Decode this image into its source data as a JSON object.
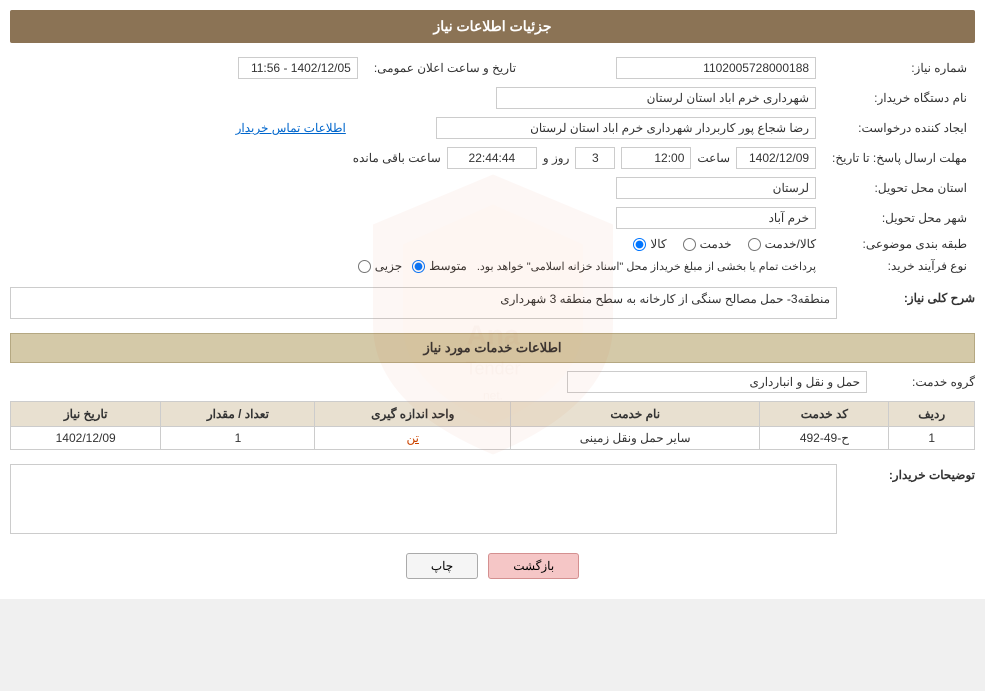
{
  "page": {
    "title": "جزئیات اطلاعات نیاز"
  },
  "header": {
    "title": "جزئیات اطلاعات نیاز"
  },
  "fields": {
    "need_number_label": "شماره نیاز:",
    "need_number_value": "1102005728000188",
    "announce_label": "تاریخ و ساعت اعلان عمومی:",
    "announce_value": "1402/12/05 - 11:56",
    "buyer_org_label": "نام دستگاه خریدار:",
    "buyer_org_value": "شهرداری خرم اباد استان لرستان",
    "creator_label": "ایجاد کننده درخواست:",
    "creator_value": "رضا شجاع پور کاربردار شهرداری خرم اباد استان لرستان",
    "contact_link": "اطلاعات تماس خریدار",
    "deadline_label": "مهلت ارسال پاسخ: تا تاریخ:",
    "deadline_date": "1402/12/09",
    "deadline_time_label": "ساعت",
    "deadline_time": "12:00",
    "deadline_days_label": "روز و",
    "deadline_days": "3",
    "deadline_remaining_label": "ساعت باقی مانده",
    "deadline_remaining": "22:44:44",
    "province_label": "استان محل تحویل:",
    "province_value": "لرستان",
    "city_label": "شهر محل تحویل:",
    "city_value": "خرم آباد",
    "category_label": "طبقه بندی موضوعی:",
    "category_kala": "کالا",
    "category_khadamat": "خدمت",
    "category_kala_khadamat": "کالا/خدمت",
    "process_label": "نوع فرآیند خرید:",
    "process_jozvi": "جزیی",
    "process_motavaset": "متوسط",
    "process_notice": "پرداخت تمام یا بخشی از مبلغ خریداز محل \"اسناد خزانه اسلامی\" خواهد بود.",
    "description_label": "شرح کلی نیاز:",
    "description_value": "منطقه3- حمل مصالح سنگی از کارخانه به سطح منطقه 3 شهرداری",
    "services_section_label": "اطلاعات خدمات مورد نیاز",
    "service_group_label": "گروه خدمت:",
    "service_group_value": "حمل و نقل و انبارداری",
    "table": {
      "headers": [
        "ردیف",
        "کد خدمت",
        "نام خدمت",
        "واحد اندازه گیری",
        "تعداد / مقدار",
        "تاریخ نیاز"
      ],
      "rows": [
        {
          "row": "1",
          "code": "ح-49-492",
          "name": "سایر حمل ونقل زمینی",
          "unit": "تن",
          "qty": "1",
          "date": "1402/12/09"
        }
      ]
    },
    "buyer_notes_label": "توضیحات خریدار:",
    "buyer_notes_value": ""
  },
  "buttons": {
    "print": "چاپ",
    "back": "بازگشت"
  },
  "radios": {
    "category_selected": "kala",
    "process_selected": "motavaset"
  }
}
